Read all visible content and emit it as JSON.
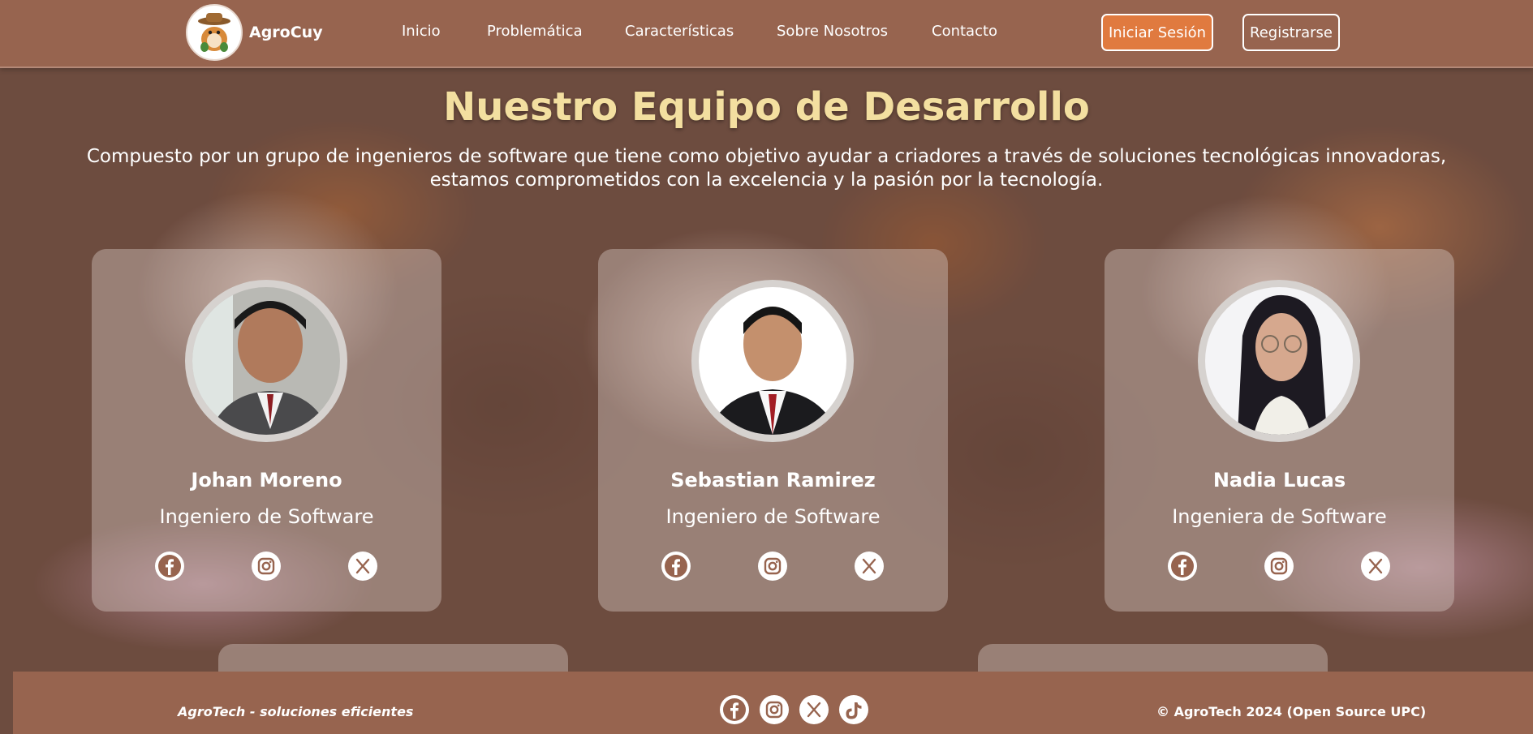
{
  "header": {
    "brand": "AgroCuy",
    "nav": [
      {
        "label": "Inicio"
      },
      {
        "label": "Problemática"
      },
      {
        "label": "Características"
      },
      {
        "label": "Sobre Nosotros"
      },
      {
        "label": "Contacto"
      }
    ],
    "login_label": "Iniciar Sesión",
    "register_label": "Registrarse"
  },
  "hero": {
    "title": "Nuestro Equipo de Desarrollo",
    "subtitle": "Compuesto por un grupo de ingenieros de software que tiene como objetivo ayudar a criadores a través de soluciones tecnológicas innovadoras, estamos comprometidos con la excelencia y la pasión por la tecnología."
  },
  "team": [
    {
      "name": "Johan Moreno",
      "role": "Ingeniero de Software",
      "icons": [
        "facebook-icon",
        "instagram-icon",
        "x-icon"
      ]
    },
    {
      "name": "Sebastian Ramirez",
      "role": "Ingeniero de Software",
      "icons": [
        "facebook-icon",
        "instagram-icon",
        "x-icon"
      ]
    },
    {
      "name": "Nadia Lucas",
      "role": "Ingeniera de Software",
      "icons": [
        "facebook-icon",
        "instagram-icon",
        "x-icon"
      ]
    }
  ],
  "footer": {
    "tagline": "AgroTech - soluciones eficientes",
    "copyright": "© AgroTech 2024 (Open Source UPC)",
    "icons": [
      "facebook-icon",
      "instagram-icon",
      "x-icon",
      "tiktok-icon"
    ]
  },
  "colors": {
    "navbar": "#97644f",
    "accent": "#e07a3f",
    "title": "#f3dfa0",
    "social_icon": "#97644f"
  }
}
